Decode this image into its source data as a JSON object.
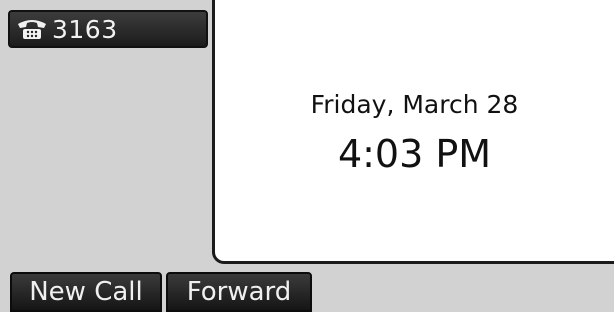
{
  "line_key": {
    "icon": "phone-icon",
    "number": "3163"
  },
  "idle_display": {
    "date": "Friday, March 28",
    "time": "4:03 PM"
  },
  "softkeys": [
    {
      "label": "New Call"
    },
    {
      "label": "Forward"
    }
  ],
  "colors": {
    "background": "#d2d2d2",
    "panel": "#ffffff",
    "key": "#1c1c1c",
    "key_text": "#f0f0f0"
  }
}
